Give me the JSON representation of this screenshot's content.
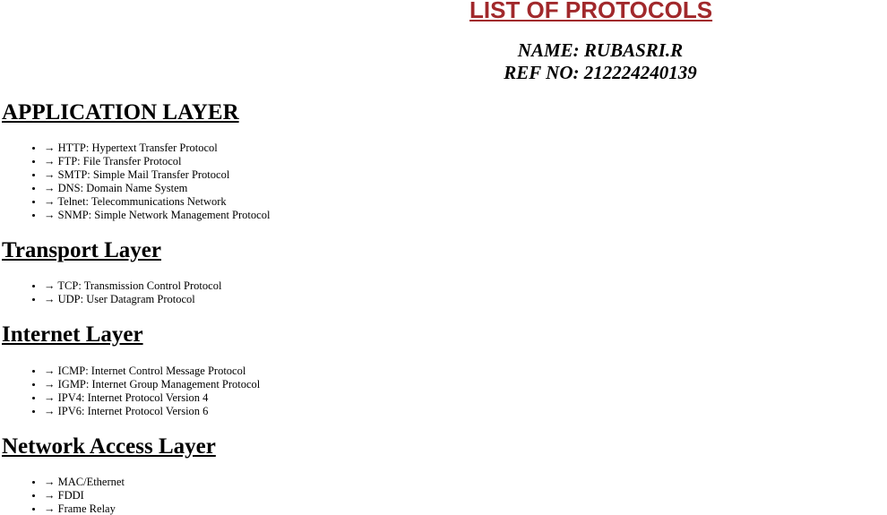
{
  "page": {
    "title": "LIST OF PROTOCOLS",
    "name_line": "NAME: RUBASRI.R",
    "ref_line": "REF NO: 212224240139",
    "title_color": "#a1282b"
  },
  "sections": [
    {
      "heading": "APPLICATION LAYER",
      "items": [
        "→ HTTP: Hypertext Transfer Protocol",
        "→ FTP: File Transfer Protocol",
        "→ SMTP: Simple Mail Transfer Protocol",
        "→ DNS: Domain Name System",
        "→ Telnet: Telecommunications Network",
        "→ SNMP: Simple Network Management Protocol"
      ]
    },
    {
      "heading": "Transport Layer",
      "items": [
        "→ TCP: Transmission Control Protocol",
        "→ UDP: User Datagram Protocol"
      ]
    },
    {
      "heading": "Internet Layer",
      "items": [
        "→ ICMP: Internet Control Message Protocol",
        "→ IGMP: Internet Group Management Protocol",
        "→ IPV4: Internet Protocol Version 4",
        "→ IPV6: Internet Protocol Version 6"
      ]
    },
    {
      "heading": "Network Access Layer",
      "items": [
        "→ MAC/Ethernet",
        "→ FDDI",
        "→ Frame Relay"
      ]
    }
  ]
}
